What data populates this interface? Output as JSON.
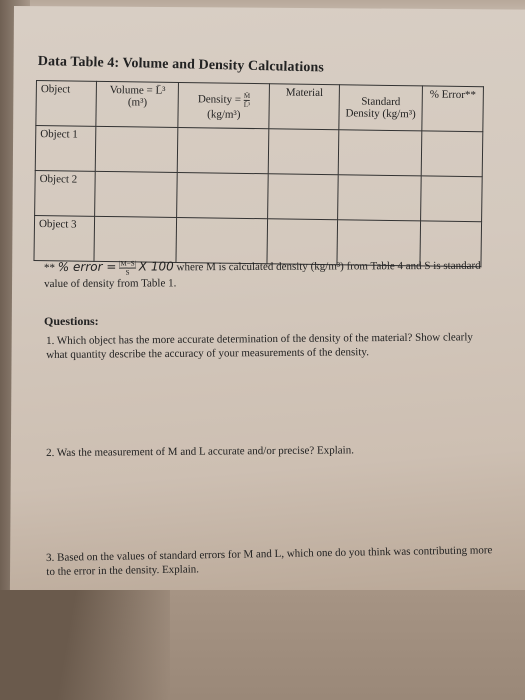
{
  "document": {
    "title": "Data Table 4: Volume and Density Calculations",
    "table": {
      "headers": [
        {
          "label": "Object"
        },
        {
          "label": "Volume = L̄³",
          "unit": "(m³)"
        },
        {
          "label": "Density =",
          "fraction_num": "M̄",
          "fraction_den": "L̄³",
          "unit": "(kg/m³)"
        },
        {
          "label": "Material"
        },
        {
          "label": "Standard",
          "unit": "Density (kg/m³)"
        },
        {
          "label": "% Error**"
        }
      ],
      "rows": [
        {
          "label": "Object 1",
          "cells": [
            "",
            "",
            "",
            "",
            ""
          ]
        },
        {
          "label": "Object 2",
          "cells": [
            "",
            "",
            "",
            "",
            ""
          ]
        },
        {
          "label": "Object 3",
          "cells": [
            "",
            "",
            "",
            "",
            ""
          ]
        }
      ]
    },
    "footnote": {
      "prefix": "** ",
      "formula_lhs": "% error =",
      "formula_num": "|M−S|",
      "formula_den": "S",
      "formula_rhs": "X 100",
      "text": "where M is calculated density (kg/m³) from Table 4 and S is standard value of density from Table 1."
    },
    "questions_heading": "Questions:",
    "questions": [
      "1. Which object has the more accurate determination of the density of the material? Show clearly what quantity describe the accuracy of your measurements of the density.",
      "2. Was the measurement of M and L accurate and/or precise? Explain.",
      "3. Based on the values of standard errors for M and L, which one do you think was contributing more to the error in the density. Explain."
    ]
  }
}
